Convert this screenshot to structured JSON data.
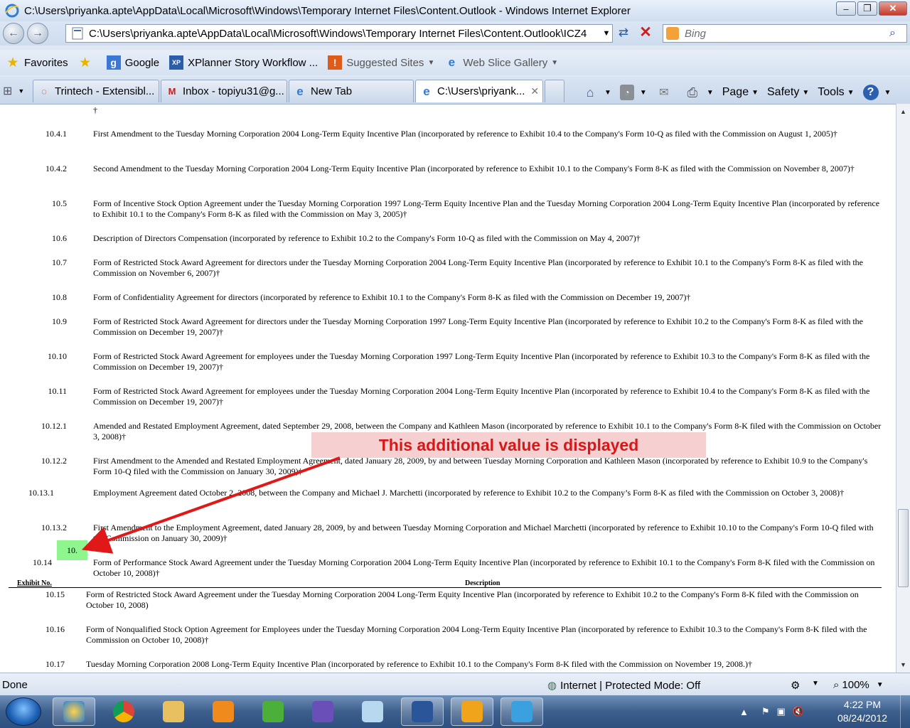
{
  "window": {
    "title": "C:\\Users\\priyanka.apte\\AppData\\Local\\Microsoft\\Windows\\Temporary Internet Files\\Content.Outlook - Windows Internet Explorer",
    "minimize": "–",
    "restore": "❐",
    "close": "✕"
  },
  "nav": {
    "back": "←",
    "forward": "→",
    "address": "C:\\Users\\priyanka.apte\\AppData\\Local\\Microsoft\\Windows\\Temporary Internet Files\\Content.Outlook\\ICZ4",
    "search_placeholder": "Bing"
  },
  "favorites": {
    "label": "Favorites",
    "items": [
      "Google",
      "XPlanner Story Workflow ...",
      "Suggested Sites",
      "Web Slice Gallery"
    ]
  },
  "tabs": [
    {
      "label": "Trintech - Extensibl...",
      "active": false
    },
    {
      "label": "Inbox - topiyu31@g...",
      "active": false
    },
    {
      "label": "New Tab",
      "active": false
    },
    {
      "label": "C:\\Users\\priyank...",
      "active": true
    }
  ],
  "commands": [
    "Page",
    "Safety",
    "Tools"
  ],
  "document": {
    "top_dagger": "†",
    "rows": [
      {
        "num": "10.4.1",
        "text": "First Amendment to the Tuesday Morning Corporation 2004 Long-Term Equity Incentive Plan (incorporated by reference to Exhibit 10.4 to the Company's Form 10-Q as filed with the Commission on August 1, 2005)†"
      },
      {
        "num": "10.4.2",
        "text": "Second Amendment to the Tuesday Morning Corporation 2004 Long-Term Equity Incentive Plan (incorporated by reference to Exhibit 10.1 to the Company's Form 8-K as filed with the Commission on November 8, 2007)†"
      },
      {
        "num": "10.5",
        "text": "Form of Incentive Stock Option Agreement under the Tuesday Morning Corporation 1997 Long-Term Equity Incentive Plan and the Tuesday Morning Corporation 2004 Long-Term Equity Incentive Plan (incorporated by reference to Exhibit 10.1 to the Company's Form 8-K as filed with the Commission on May 3, 2005)†"
      },
      {
        "num": "10.6",
        "text": "Description of Directors Compensation (incorporated by reference to Exhibit 10.2 to the Company's Form 10-Q as filed with the Commission on May 4, 2007)†"
      },
      {
        "num": "10.7",
        "text": "Form of Restricted Stock Award Agreement for directors under the Tuesday Morning Corporation 2004 Long-Term Equity Incentive Plan (incorporated by reference to Exhibit 10.1 to the Company's Form 8-K as filed with the Commission on November 6, 2007)†"
      },
      {
        "num": "10.8",
        "text": "Form of Confidentiality Agreement for directors (incorporated by reference to Exhibit 10.1 to the Company's Form 8-K as filed with the Commission on December 19, 2007)†"
      },
      {
        "num": "10.9",
        "text": "Form of Restricted Stock Award Agreement for directors under the Tuesday Morning Corporation 1997 Long-Term Equity Incentive Plan (incorporated by reference to Exhibit 10.2 to the Company's Form 8-K as filed with the Commission on December 19, 2007)†"
      },
      {
        "num": "10.10",
        "text": "Form of Restricted Stock Award Agreement for employees under the Tuesday Morning Corporation 1997 Long-Term Equity Incentive Plan (incorporated by reference to Exhibit 10.3 to the Company's Form 8-K as filed with the Commission on December 19, 2007)†"
      },
      {
        "num": "10.11",
        "text": "Form of Restricted Stock Award Agreement for employees under the Tuesday Morning Corporation 2004 Long-Term Equity Incentive Plan (incorporated by reference to Exhibit 10.4 to the Company's Form 8-K as filed with the Commission on December 19, 2007)†"
      },
      {
        "num": "10.12.1",
        "text": "Amended and Restated Employment Agreement, dated September 29, 2008, between the Company and Kathleen Mason (incorporated by reference to Exhibit 10.1 to the Company's Form 8-K filed with the Commission on October 3, 2008)†"
      },
      {
        "num": "10.12.2",
        "text": "First Amendment to the Amended and Restated Employment Agreement, dated January 28, 2009, by and between Tuesday Morning Corporation and Kathleen Mason (incorporated by reference to Exhibit 10.9 to the Company's Form 10-Q filed with the Commission on January 30, 2009)†"
      },
      {
        "num": "10.13.1",
        "text": "Employment Agreement dated October 2, 2008, between the Company and Michael J. Marchetti (incorporated by reference to Exhibit 10.2 to the Company’s Form 8-K as filed with the Commission on October 3, 2008)†"
      },
      {
        "num": "10.13.2",
        "text": "First Amendment to the Employment Agreement, dated January 28, 2009, by and between Tuesday Morning Corporation and Michael Marchetti (incorporated by reference to Exhibit 10.10 to the Company's Form 10-Q filed with the Commission on January 30, 2009)†"
      },
      {
        "num": "10.14",
        "text": "Form of Performance Stock Award Agreement under the Tuesday Morning Corporation 2004 Long-Term Equity Incentive Plan (incorporated by reference to Exhibit 10.1 to the Company's Form 8-K filed with the Commission on October 10, 2008)†"
      }
    ],
    "header": {
      "exhibit": "Exhibit No.",
      "description": "Description"
    },
    "rows2": [
      {
        "num": "10.15",
        "text": "Form of Restricted Stock Award Agreement under the Tuesday Morning Corporation 2004 Long-Term Equity Incentive Plan (incorporated by reference to Exhibit 10.2 to the Company's Form 8-K filed with the Commission on October 10, 2008)"
      },
      {
        "num": "10.16",
        "text": "Form of Nonqualified Stock Option Agreement for Employees under the Tuesday Morning Corporation 2004 Long-Term Equity Incentive Plan (incorporated by reference to Exhibit 10.3 to the Company's Form 8-K filed with the Commission on October 10, 2008)†"
      },
      {
        "num": "10.17",
        "text": "Tuesday Morning Corporation 2008 Long-Term Equity Incentive Plan (incorporated by reference to Exhibit 10.1 to the Company's Form 8-K filed with the Commission on November 19, 2008.)†"
      }
    ]
  },
  "annotation": {
    "callout": "This additional value is displayed",
    "green_value": "10."
  },
  "status": {
    "left": "Done",
    "zone": "Internet | Protected Mode: Off",
    "zoom": "100%"
  },
  "clock": {
    "time": "4:22 PM",
    "date": "08/24/2012"
  },
  "colors": {
    "callout_bg": "#f6cfd0",
    "callout_text": "#d81818",
    "green_box": "#8ff58f",
    "arrow": "#e01818"
  }
}
